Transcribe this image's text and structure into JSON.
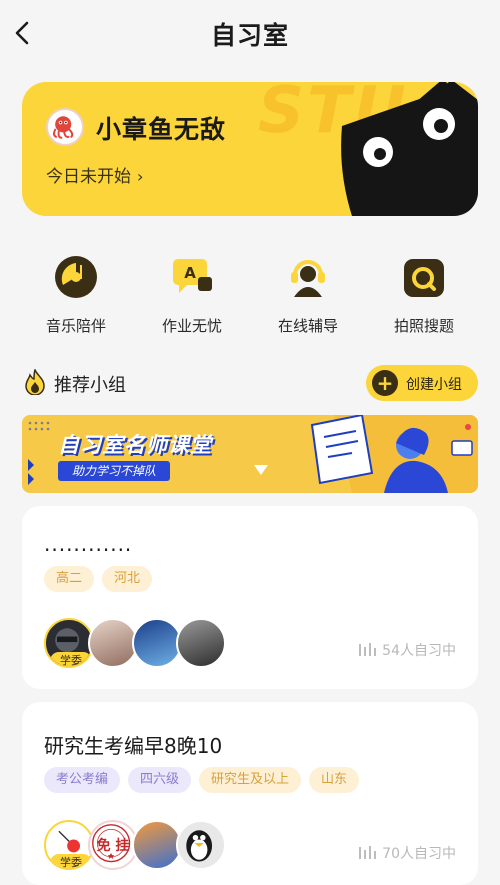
{
  "header": {
    "title": "自习室"
  },
  "hero": {
    "name": "小章鱼无敌",
    "status": "今日未开始",
    "status_chevron": "›",
    "decor_text": "STU"
  },
  "shortcuts": [
    {
      "label": "音乐陪伴",
      "icon": "music-icon"
    },
    {
      "label": "作业无忧",
      "icon": "homework-icon"
    },
    {
      "label": "在线辅导",
      "icon": "tutor-icon"
    },
    {
      "label": "拍照搜题",
      "icon": "camera-search-icon"
    }
  ],
  "section": {
    "title": "推荐小组",
    "create_label": "创建小组",
    "create_plus": "+"
  },
  "banner": {
    "title": "自习室名师课堂",
    "subtitle": "助力学习不掉队"
  },
  "groups": [
    {
      "title": "............",
      "tags": [
        "高二",
        "河北"
      ],
      "badge": "学委",
      "count": "54人自习中"
    },
    {
      "title": "研究生考编早8晚10",
      "tags": [
        "考公考编",
        "四六级",
        "研究生及以上",
        "山东"
      ],
      "badge": "学委",
      "count": "70人自习中",
      "seal_text": "免 挂"
    }
  ],
  "colors": {
    "accent": "#fbd539",
    "dark": "#3a2f15",
    "tag_yellow": "#fdf0d4",
    "tag_purple": "#ece8fb"
  }
}
